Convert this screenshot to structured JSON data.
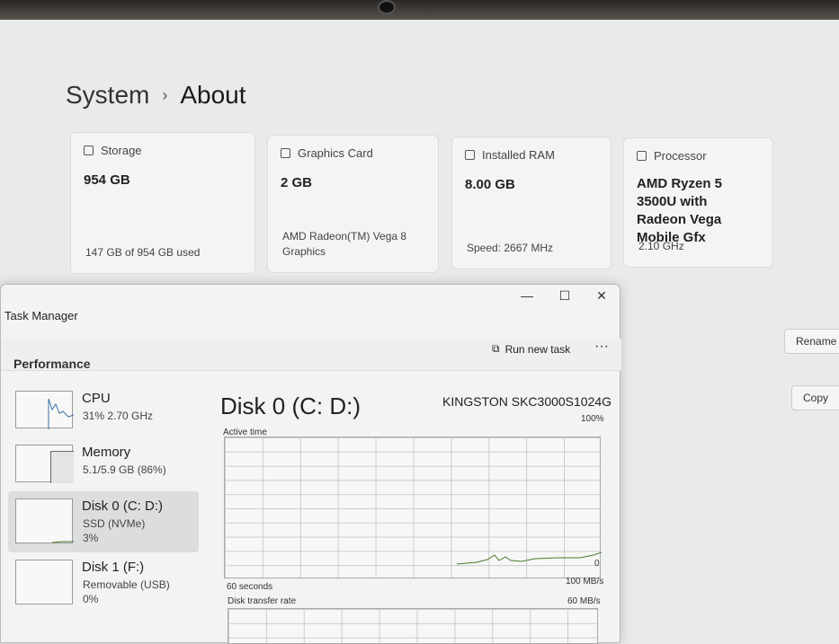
{
  "breadcrumb": {
    "parent": "System",
    "separator": "›",
    "current": "About"
  },
  "cards": [
    {
      "label": "Storage",
      "value": "954 GB",
      "sub": "147 GB of 954 GB used"
    },
    {
      "label": "Graphics Card",
      "value": "2 GB",
      "sub": "AMD Radeon(TM) Vega 8 Graphics"
    },
    {
      "label": "Installed RAM",
      "value": "8.00 GB",
      "sub": "Speed: 2667 MHz"
    },
    {
      "label": "Processor",
      "value": "AMD Ryzen 5 3500U with Radeon Vega Mobile Gfx",
      "sub": "2.10 GHz"
    }
  ],
  "right_buttons": {
    "rename": "Rename t",
    "copy": "Copy"
  },
  "task_manager": {
    "title": "Task Manager",
    "controls": {
      "minimize": "—",
      "maximize": "☐",
      "close": "✕"
    },
    "section": "Performance",
    "run_new_task": "Run new task",
    "more": "···",
    "items": [
      {
        "name": "CPU",
        "sub1": "31% 2.70 GHz",
        "sub2": ""
      },
      {
        "name": "Memory",
        "sub1": "5.1/5.9 GB (86%)",
        "sub2": ""
      },
      {
        "name": "Disk 0 (C: D:)",
        "sub1": "SSD (NVMe)",
        "sub2": "3%"
      },
      {
        "name": "Disk 1 (F:)",
        "sub1": "Removable (USB)",
        "sub2": "0%"
      }
    ],
    "detail": {
      "title": "Disk 0 (C: D:)",
      "model": "KINGSTON SKC3000S1024G",
      "active_time": "Active time",
      "max_pct": "100%",
      "zero": "0",
      "seconds": "60 seconds",
      "rate_max": "100 MB/s",
      "transfer_label": "Disk transfer rate",
      "rate_mid": "60 MB/s"
    }
  }
}
